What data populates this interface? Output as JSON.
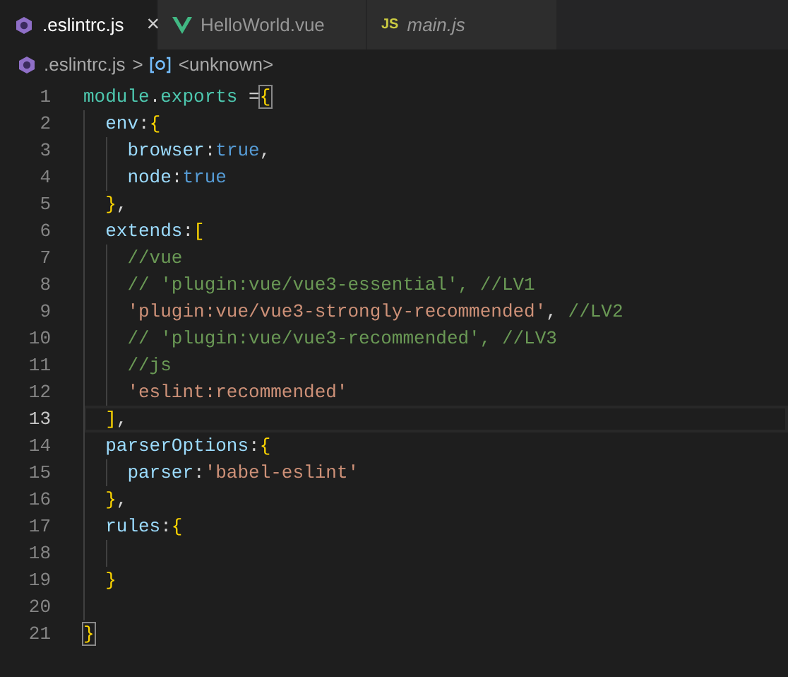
{
  "tabs": [
    {
      "kind": "eslint",
      "label": ".eslintrc.js",
      "selected": true,
      "close": "×",
      "preview": false
    },
    {
      "kind": "vue",
      "label": "HelloWorld.vue",
      "selected": false,
      "preview": false
    },
    {
      "kind": "js",
      "icon_text": "JS",
      "label": "main.js",
      "selected": false,
      "preview": true
    }
  ],
  "breadcrumb": {
    "file": ".eslintrc.js",
    "separator": ">",
    "symbol": "<unknown>"
  },
  "lines": [
    {
      "number": "1",
      "current": false,
      "tokens": [
        {
          "text": "module",
          "kind": "module"
        },
        {
          "text": ".",
          "kind": "punct"
        },
        {
          "text": "exports",
          "kind": "module"
        },
        {
          "text": " =",
          "kind": "punct"
        },
        {
          "text": "{",
          "kind": "bracket",
          "matched": true
        }
      ]
    },
    {
      "number": "2",
      "current": false,
      "tokens": [
        {
          "text": "  env",
          "kind": "prop"
        },
        {
          "text": ":",
          "kind": "punct"
        },
        {
          "text": "{",
          "kind": "bracket",
          "matched": false
        }
      ]
    },
    {
      "number": "3",
      "current": false,
      "tokens": [
        {
          "text": "    browser",
          "kind": "prop"
        },
        {
          "text": ":",
          "kind": "punct"
        },
        {
          "text": "true",
          "kind": "bool"
        },
        {
          "text": ",",
          "kind": "punct"
        }
      ]
    },
    {
      "number": "4",
      "current": false,
      "tokens": [
        {
          "text": "    node",
          "kind": "prop"
        },
        {
          "text": ":",
          "kind": "punct"
        },
        {
          "text": "true",
          "kind": "bool"
        }
      ]
    },
    {
      "number": "5",
      "current": false,
      "tokens": [
        {
          "text": "  }",
          "kind": "bracket",
          "matched": false
        },
        {
          "text": ",",
          "kind": "punct"
        }
      ]
    },
    {
      "number": "6",
      "current": false,
      "tokens": [
        {
          "text": "  extends",
          "kind": "prop"
        },
        {
          "text": ":",
          "kind": "punct"
        },
        {
          "text": "[",
          "kind": "bracket",
          "matched": false
        }
      ]
    },
    {
      "number": "7",
      "current": false,
      "tokens": [
        {
          "text": "    //vue",
          "kind": "comment"
        }
      ]
    },
    {
      "number": "8",
      "current": false,
      "tokens": [
        {
          "text": "    // 'plugin:vue/vue3-essential', //LV1",
          "kind": "comment"
        }
      ]
    },
    {
      "number": "9",
      "current": false,
      "tokens": [
        {
          "text": "    'plugin:vue/vue3-strongly-recommended'",
          "kind": "string"
        },
        {
          "text": ", ",
          "kind": "punct"
        },
        {
          "text": "//LV2",
          "kind": "comment"
        }
      ]
    },
    {
      "number": "10",
      "current": false,
      "tokens": [
        {
          "text": "    // 'plugin:vue/vue3-recommended', //LV3",
          "kind": "comment"
        }
      ]
    },
    {
      "number": "11",
      "current": false,
      "tokens": [
        {
          "text": "    //js",
          "kind": "comment"
        }
      ]
    },
    {
      "number": "12",
      "current": false,
      "tokens": [
        {
          "text": "    'eslint:recommended'",
          "kind": "string"
        }
      ]
    },
    {
      "number": "13",
      "current": true,
      "tokens": [
        {
          "text": "  ]",
          "kind": "bracket",
          "matched": false
        },
        {
          "text": ",",
          "kind": "punct"
        }
      ]
    },
    {
      "number": "14",
      "current": false,
      "tokens": [
        {
          "text": "  parserOptions",
          "kind": "prop"
        },
        {
          "text": ":",
          "kind": "punct"
        },
        {
          "text": "{",
          "kind": "bracket",
          "matched": false
        }
      ]
    },
    {
      "number": "15",
      "current": false,
      "tokens": [
        {
          "text": "    parser",
          "kind": "prop"
        },
        {
          "text": ":",
          "kind": "punct"
        },
        {
          "text": "'babel-eslint'",
          "kind": "string"
        }
      ]
    },
    {
      "number": "16",
      "current": false,
      "tokens": [
        {
          "text": "  }",
          "kind": "bracket",
          "matched": false
        },
        {
          "text": ",",
          "kind": "punct"
        }
      ]
    },
    {
      "number": "17",
      "current": false,
      "tokens": [
        {
          "text": "  rules",
          "kind": "prop"
        },
        {
          "text": ":",
          "kind": "punct"
        },
        {
          "text": "{",
          "kind": "bracket",
          "matched": false
        }
      ]
    },
    {
      "number": "18",
      "current": false
    },
    {
      "number": "19",
      "current": false,
      "tokens": [
        {
          "text": "  }",
          "kind": "bracket",
          "matched": false
        }
      ]
    },
    {
      "number": "20",
      "current": false
    },
    {
      "number": "21",
      "current": false,
      "tokens": [
        {
          "text": "}",
          "kind": "bracket",
          "matched": true
        }
      ]
    }
  ]
}
